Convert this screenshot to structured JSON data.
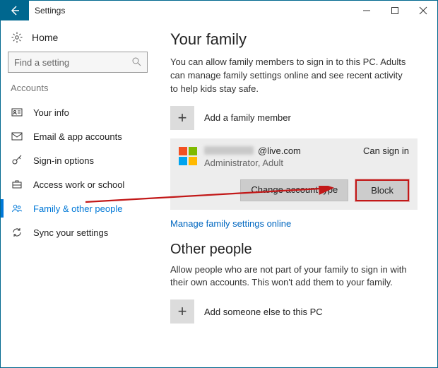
{
  "window": {
    "title": "Settings"
  },
  "sidebar": {
    "home_label": "Home",
    "search_placeholder": "Find a setting",
    "section_label": "Accounts",
    "items": [
      {
        "label": "Your info",
        "icon": "person-card-icon",
        "selected": false
      },
      {
        "label": "Email & app accounts",
        "icon": "mail-icon",
        "selected": false
      },
      {
        "label": "Sign-in options",
        "icon": "key-icon",
        "selected": false
      },
      {
        "label": "Access work or school",
        "icon": "briefcase-icon",
        "selected": false
      },
      {
        "label": "Family & other people",
        "icon": "people-icon",
        "selected": true
      },
      {
        "label": "Sync your settings",
        "icon": "sync-icon",
        "selected": false
      }
    ]
  },
  "main": {
    "family": {
      "heading": "Your family",
      "description": "You can allow family members to sign in to this PC. Adults can manage family settings online and see recent activity to help kids stay safe.",
      "add_label": "Add a family member",
      "member": {
        "email_domain": "@live.com",
        "role": "Administrator, Adult",
        "status": "Can sign in",
        "change_type_label": "Change account type",
        "block_label": "Block"
      },
      "manage_link": "Manage family settings online"
    },
    "other": {
      "heading": "Other people",
      "description": "Allow people who are not part of your family to sign in with their own accounts. This won't add them to your family.",
      "add_label": "Add someone else to this PC"
    }
  }
}
